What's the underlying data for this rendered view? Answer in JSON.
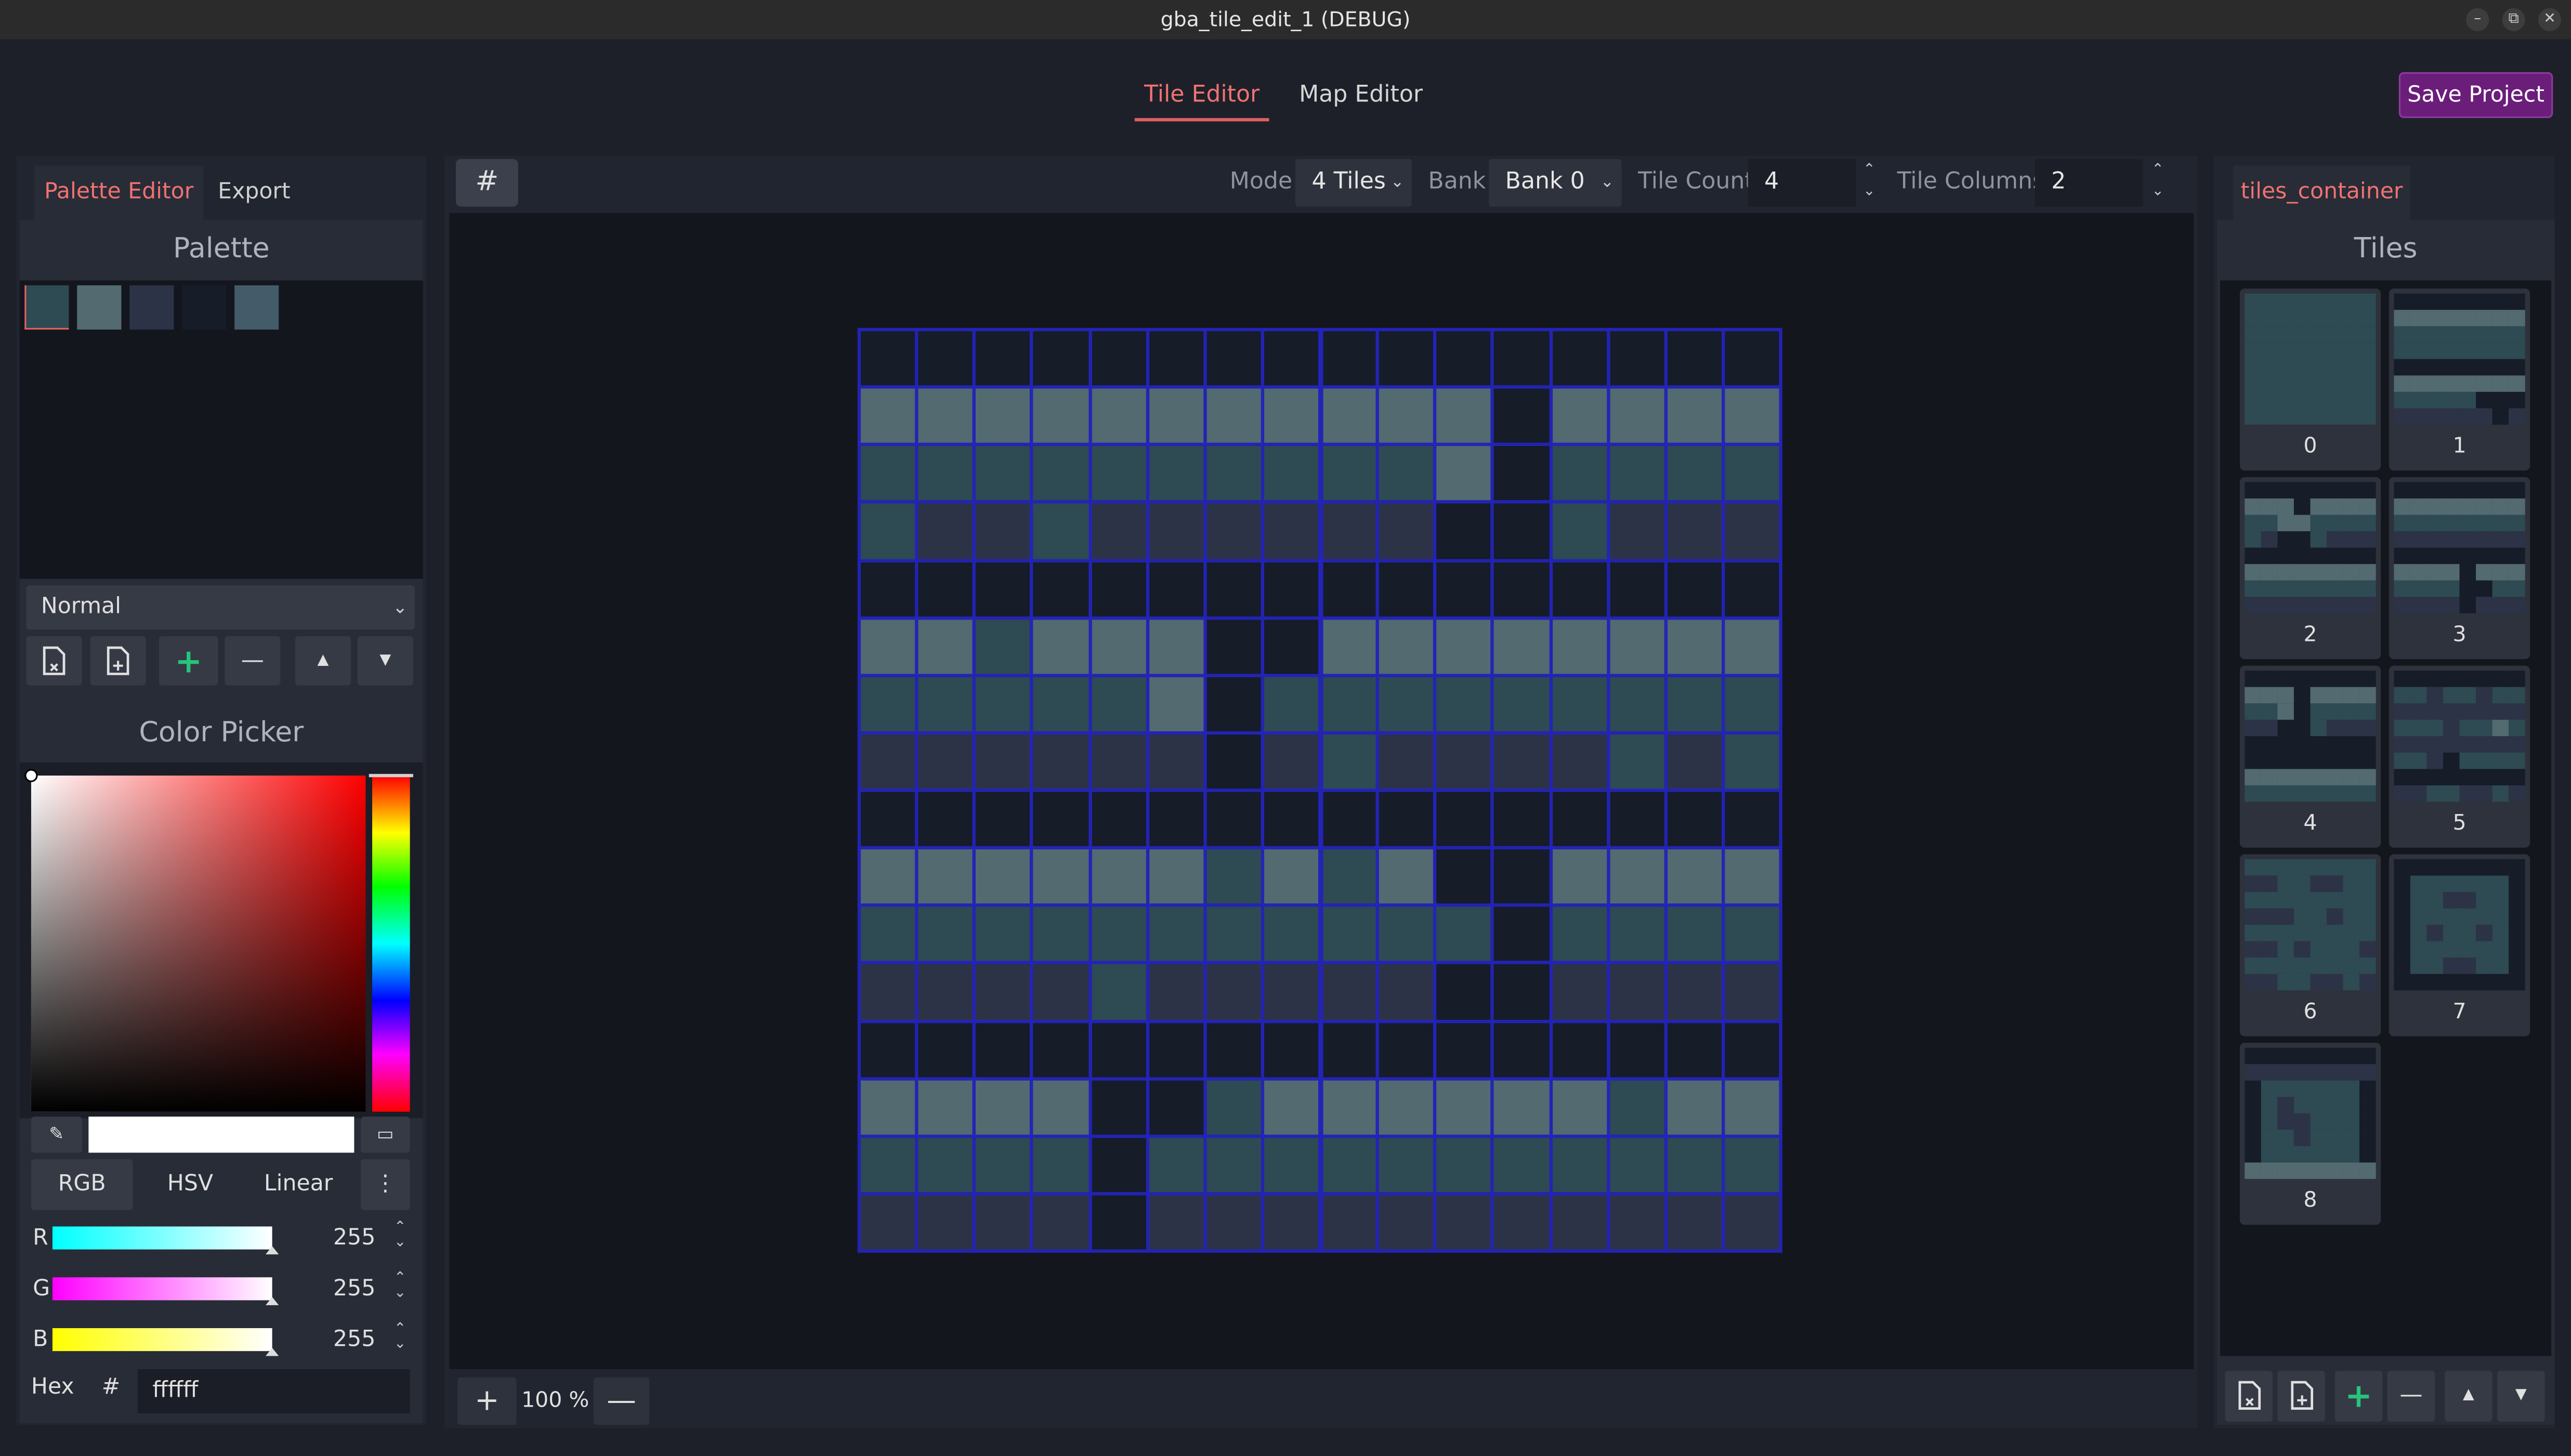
{
  "window": {
    "title": "gba_tile_edit_1 (DEBUG)",
    "buttons": [
      "–",
      "⧉",
      "✕"
    ]
  },
  "top_tabs": [
    {
      "label": "Tile Editor",
      "active": true
    },
    {
      "label": "Map Editor",
      "active": false
    }
  ],
  "save_label": "Save Project",
  "left": {
    "tabs": [
      {
        "label": "Palette Editor",
        "active": true
      },
      {
        "label": "Export",
        "active": false
      }
    ],
    "palette_title": "Palette",
    "palette_colors": [
      "#2e4a52",
      "#526a70",
      "#2d3346",
      "#161c28",
      "#445b69"
    ],
    "selected_swatch": 0,
    "blend_mode": "Normal",
    "palette_buttons": [
      "new-file-icon",
      "load-file-icon",
      "add-icon",
      "remove-icon",
      "move-up-icon",
      "move-down-icon"
    ],
    "color_picker": {
      "title": "Color Picker",
      "modes": [
        "RGB",
        "HSV",
        "Linear"
      ],
      "active_mode": "RGB",
      "channels": [
        {
          "label": "R",
          "value": "255"
        },
        {
          "label": "G",
          "value": "255"
        },
        {
          "label": "B",
          "value": "255"
        }
      ],
      "hex_label": "Hex",
      "hash": "#",
      "hex": "ffffff"
    }
  },
  "toolbar": {
    "mode_label": "Mode",
    "mode_value": "4 Tiles",
    "bank_label": "Bank",
    "bank_value": "Bank 0",
    "tile_count_label": "Tile Count",
    "tile_count": "4",
    "tile_columns_label": "Tile Columns",
    "tile_columns": "2"
  },
  "zoom": "100 %",
  "colors": {
    "0": "#161c28",
    "1": "#526a70",
    "2": "#2e4a52",
    "3": "#2d3346",
    "grid": "#2323b8",
    "accent": "#f07272",
    "save_bg": "#6b1d7a",
    "add_green": "#27c37b"
  },
  "canvas_grid": [
    "0000000000000000",
    "1111111111101111",
    "2222222222102222",
    "2332333333002333",
    "0000000000000000",
    "1121110011111111",
    "2222210222222222",
    "3333330323333232",
    "0000000000000000",
    "1111112121001111",
    "2222222222202222",
    "3333233333003333",
    "0000000000000000",
    "1111002111111211",
    "2222022222222222",
    "3333033333333333"
  ],
  "right": {
    "tab": "tiles_container",
    "title": "Tiles",
    "tiles": [
      {
        "label": "0",
        "rows": [
          "22222222",
          "22222222",
          "22222222",
          "22222222",
          "22222222",
          "22222222",
          "22222222",
          "22222222"
        ]
      },
      {
        "label": "1",
        "rows": [
          "00000000",
          "11111111",
          "22222222",
          "22222222",
          "00000000",
          "11111111",
          "22222000",
          "33333303"
        ]
      },
      {
        "label": "2",
        "rows": [
          "00000000",
          "11101111",
          "22112222",
          "23002333",
          "00000000",
          "11111111",
          "22222222",
          "33333333"
        ]
      },
      {
        "label": "3",
        "rows": [
          "00000000",
          "11111111",
          "22222222",
          "33333333",
          "00000000",
          "11110111",
          "22220022",
          "33330333"
        ]
      },
      {
        "label": "4",
        "rows": [
          "00000000",
          "11101111",
          "22102222",
          "33002333",
          "00000000",
          "00000000",
          "11111111",
          "22222222"
        ]
      },
      {
        "label": "5",
        "rows": [
          "00000000",
          "22322322",
          "33333333",
          "22232212",
          "33333333",
          "22302222",
          "00000000",
          "33223323"
        ]
      },
      {
        "label": "6",
        "rows": [
          "22222222",
          "33223322",
          "22222222",
          "33322322",
          "22222222",
          "33232223",
          "22222222",
          "33223323"
        ]
      },
      {
        "label": "7",
        "rows": [
          "00000000",
          "02222220",
          "02233220",
          "02222220",
          "02322320",
          "02222220",
          "02233220",
          "00000000"
        ]
      },
      {
        "label": "8",
        "rows": [
          "00000000",
          "33333333",
          "02222220",
          "02322220",
          "02332220",
          "02232220",
          "02222220",
          "11111111"
        ]
      }
    ]
  }
}
